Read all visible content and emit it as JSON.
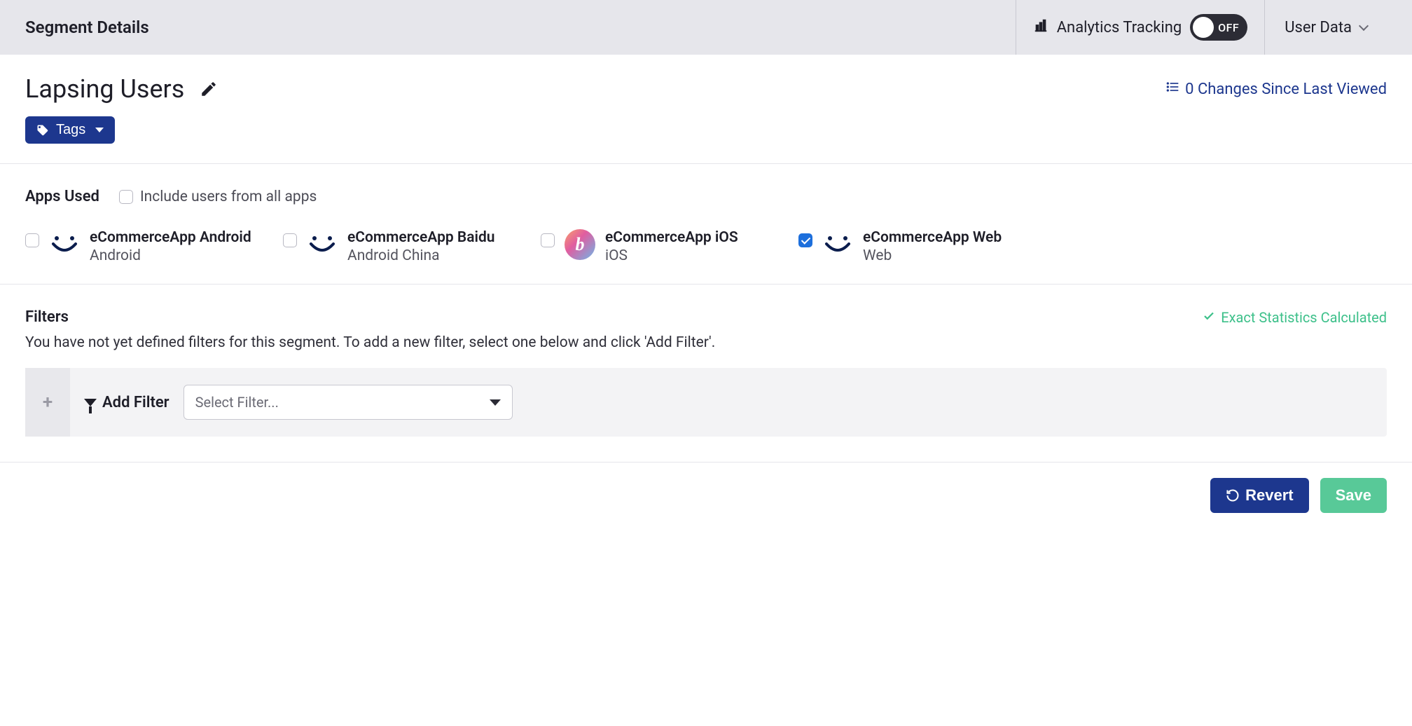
{
  "header": {
    "title": "Segment Details",
    "analytics_label": "Analytics Tracking",
    "toggle_state": "OFF",
    "user_data_label": "User Data"
  },
  "segment": {
    "name": "Lapsing Users",
    "changes_label": "0 Changes Since Last Viewed",
    "tags_button": "Tags"
  },
  "apps": {
    "section_title": "Apps Used",
    "include_all_label": "Include users from all apps",
    "items": [
      {
        "name": "eCommerceApp Android",
        "platform": "Android",
        "checked": false,
        "icon": "smile"
      },
      {
        "name": "eCommerceApp Baidu",
        "platform": "Android China",
        "checked": false,
        "icon": "smile"
      },
      {
        "name": "eCommerceApp iOS",
        "platform": "iOS",
        "checked": false,
        "icon": "gradient-b"
      },
      {
        "name": "eCommerceApp Web",
        "platform": "Web",
        "checked": true,
        "icon": "smile"
      }
    ]
  },
  "filters": {
    "section_title": "Filters",
    "exact_stats_label": "Exact Statistics Calculated",
    "description": "You have not yet defined filters for this segment. To add a new filter, select one below and click 'Add Filter'.",
    "add_filter_label": "Add Filter",
    "select_placeholder": "Select Filter..."
  },
  "footer": {
    "revert_label": "Revert",
    "save_label": "Save"
  }
}
